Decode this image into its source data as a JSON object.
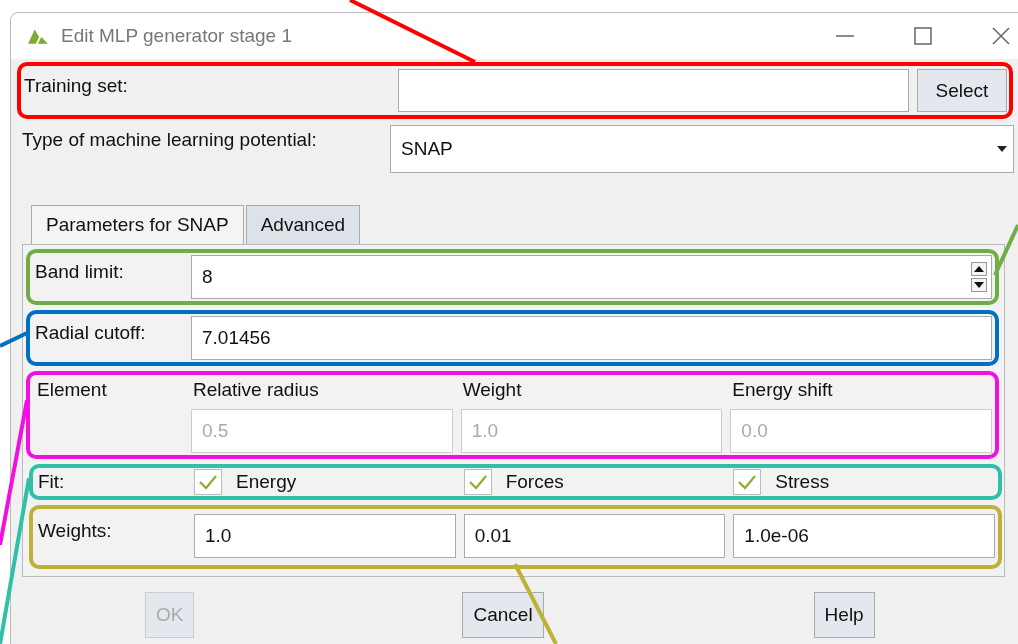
{
  "window": {
    "title": "Edit MLP generator stage 1"
  },
  "training_set": {
    "label": "Training set:",
    "button": "Select"
  },
  "potential_type": {
    "label": "Type of machine learning potential:",
    "value": "SNAP"
  },
  "tabs": [
    {
      "label": "Parameters for SNAP",
      "selected": true
    },
    {
      "label": "Advanced",
      "selected": false
    }
  ],
  "band_limit": {
    "label": "Band limit:",
    "value": "8"
  },
  "radial_cutoff": {
    "label": "Radial cutoff:",
    "value": "7.01456"
  },
  "element_table": {
    "columns": [
      "Element",
      "Relative radius",
      "Weight",
      "Energy shift"
    ],
    "values": [
      "0.5",
      "1.0",
      "0.0"
    ],
    "disabled": true
  },
  "fit": {
    "label": "Fit:",
    "options": [
      {
        "label": "Energy",
        "checked": true
      },
      {
        "label": "Forces",
        "checked": true
      },
      {
        "label": "Stress",
        "checked": true
      }
    ]
  },
  "weights": {
    "label": "Weights:",
    "values": [
      "1.0",
      "0.01",
      "1.0e-06"
    ]
  },
  "buttons": [
    {
      "label": "OK",
      "disabled": true
    },
    {
      "label": "Cancel",
      "disabled": false
    },
    {
      "label": "Help",
      "disabled": false
    }
  ],
  "annotations": [
    {
      "color": "#ff0000"
    },
    {
      "color": "#70ad47"
    },
    {
      "color": "#0070c0"
    },
    {
      "color": "#f010e0"
    },
    {
      "color": "#30c0a8"
    },
    {
      "color": "#bdb236"
    }
  ]
}
